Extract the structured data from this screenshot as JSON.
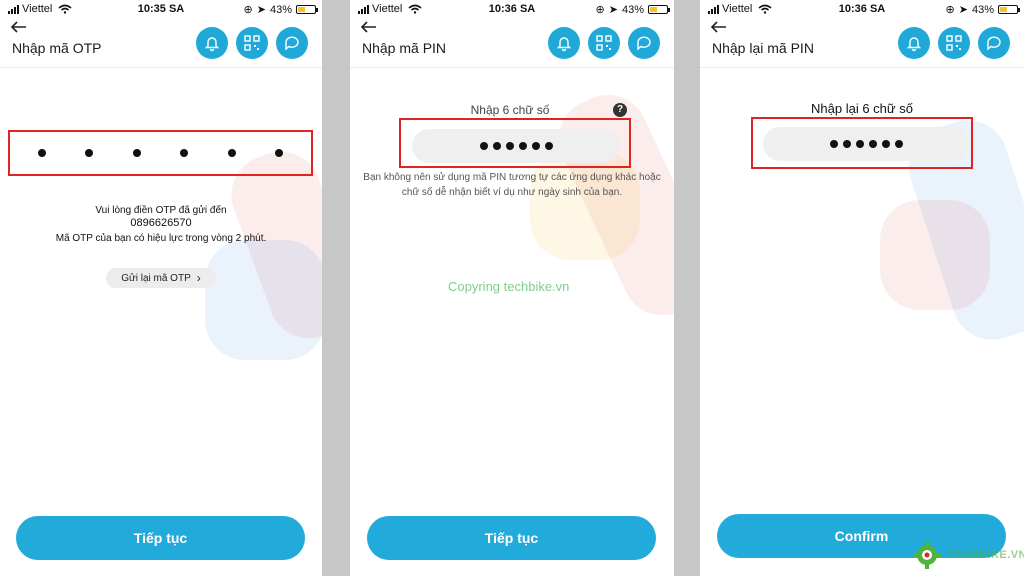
{
  "screens": [
    {
      "status": {
        "carrier": "Viettel",
        "time": "10:35 SA",
        "battery": "43%"
      },
      "title": "Nhập mã OTP",
      "message_line1": "Vui lòng điền OTP đã gửi đến",
      "phone_number": "0896626570",
      "validity": "Mã OTP của bạn có hiệu lực trong vòng 2 phút.",
      "resend_label": "Gửi lại mã OTP",
      "button_label": "Tiếp tục"
    },
    {
      "status": {
        "carrier": "Viettel",
        "time": "10:36 SA",
        "battery": "43%"
      },
      "title": "Nhập mã PIN",
      "field_label": "Nhập 6 chữ số",
      "help_glyph": "?",
      "hint": "Bạn không nên sử dụng mã PIN tương tự các ứng dụng khác hoặc chữ số dễ nhận biết ví dụ như ngày sinh của bạn.",
      "button_label": "Tiếp tục"
    },
    {
      "status": {
        "carrier": "Viettel",
        "time": "10:36 SA",
        "battery": "43%"
      },
      "title": "Nhập lại mã PIN",
      "field_label": "Nhập lại 6 chữ số",
      "button_label": "Confirm"
    }
  ],
  "watermark": "Copyring techbike.vn",
  "logo_text": "TECHBIKE.VN",
  "battery_level": 0.43,
  "colors": {
    "accent": "#22aadb",
    "highlight": "#e02424",
    "battery": "#f2c230",
    "watermark": "#7fcf8a"
  }
}
